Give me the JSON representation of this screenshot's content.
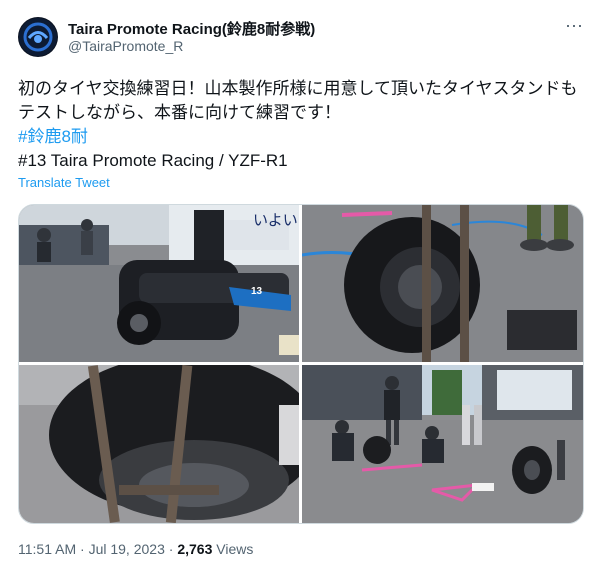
{
  "author": {
    "name": "Taira Promote Racing(鈴鹿8耐参戦)",
    "handle": "@TairaPromote_R"
  },
  "tweet": {
    "line1": "初のタイヤ交換練習日！山本製作所様に用意して頂いたタイヤスタンドも",
    "line2": "テストしながら、本番に向けて練習です！",
    "hashtag": "#鈴鹿8耐",
    "line4": "#13 Taira Promote Racing / YZF-R1",
    "translate": "Translate Tweet"
  },
  "media": {
    "photo1_sign": "いよい",
    "photo1_number": "13"
  },
  "meta": {
    "time": "11:51 AM",
    "sep1": " · ",
    "date": "Jul 19, 2023",
    "sep2": " · ",
    "views_count": "2,763",
    "views_label": " Views"
  },
  "colors": {
    "link": "#1d9bf0",
    "secondary": "#536471",
    "text": "#0f1419"
  }
}
